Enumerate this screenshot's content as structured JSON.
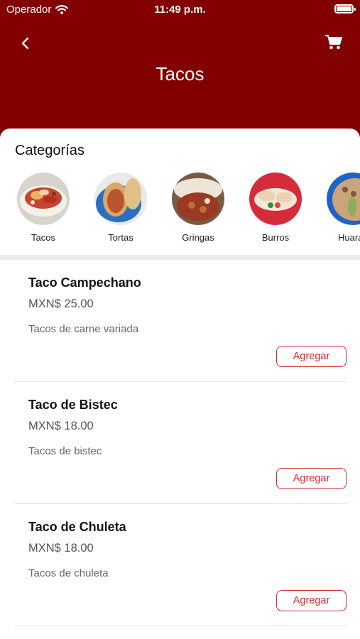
{
  "status_bar": {
    "carrier": "Operador",
    "time": "11:49 p.m.",
    "wifi_icon": "wifi-icon",
    "battery_icon": "battery-icon"
  },
  "header": {
    "title": "Tacos",
    "back_icon": "chevron-left-icon",
    "cart_icon": "cart-icon",
    "background": "#830000"
  },
  "categories": {
    "heading": "Categorías",
    "selected": "Tacos",
    "items": [
      {
        "label": "Tacos"
      },
      {
        "label": "Tortas"
      },
      {
        "label": "Gringas"
      },
      {
        "label": "Burros"
      },
      {
        "label": "Huarac"
      }
    ]
  },
  "products": [
    {
      "name": "Taco Campechano",
      "price": "MXN$ 25.00",
      "description": "Tacos de carne variada",
      "add_label": "Agregar"
    },
    {
      "name": "Taco de Bistec",
      "price": "MXN$ 18.00",
      "description": "Tacos de bistec",
      "add_label": "Agregar"
    },
    {
      "name": "Taco de Chuleta",
      "price": "MXN$ 18.00",
      "description": "Tacos de chuleta",
      "add_label": "Agregar"
    }
  ],
  "colors": {
    "accent": "#d42a2a",
    "header": "#830000",
    "divider": "#ededed"
  }
}
